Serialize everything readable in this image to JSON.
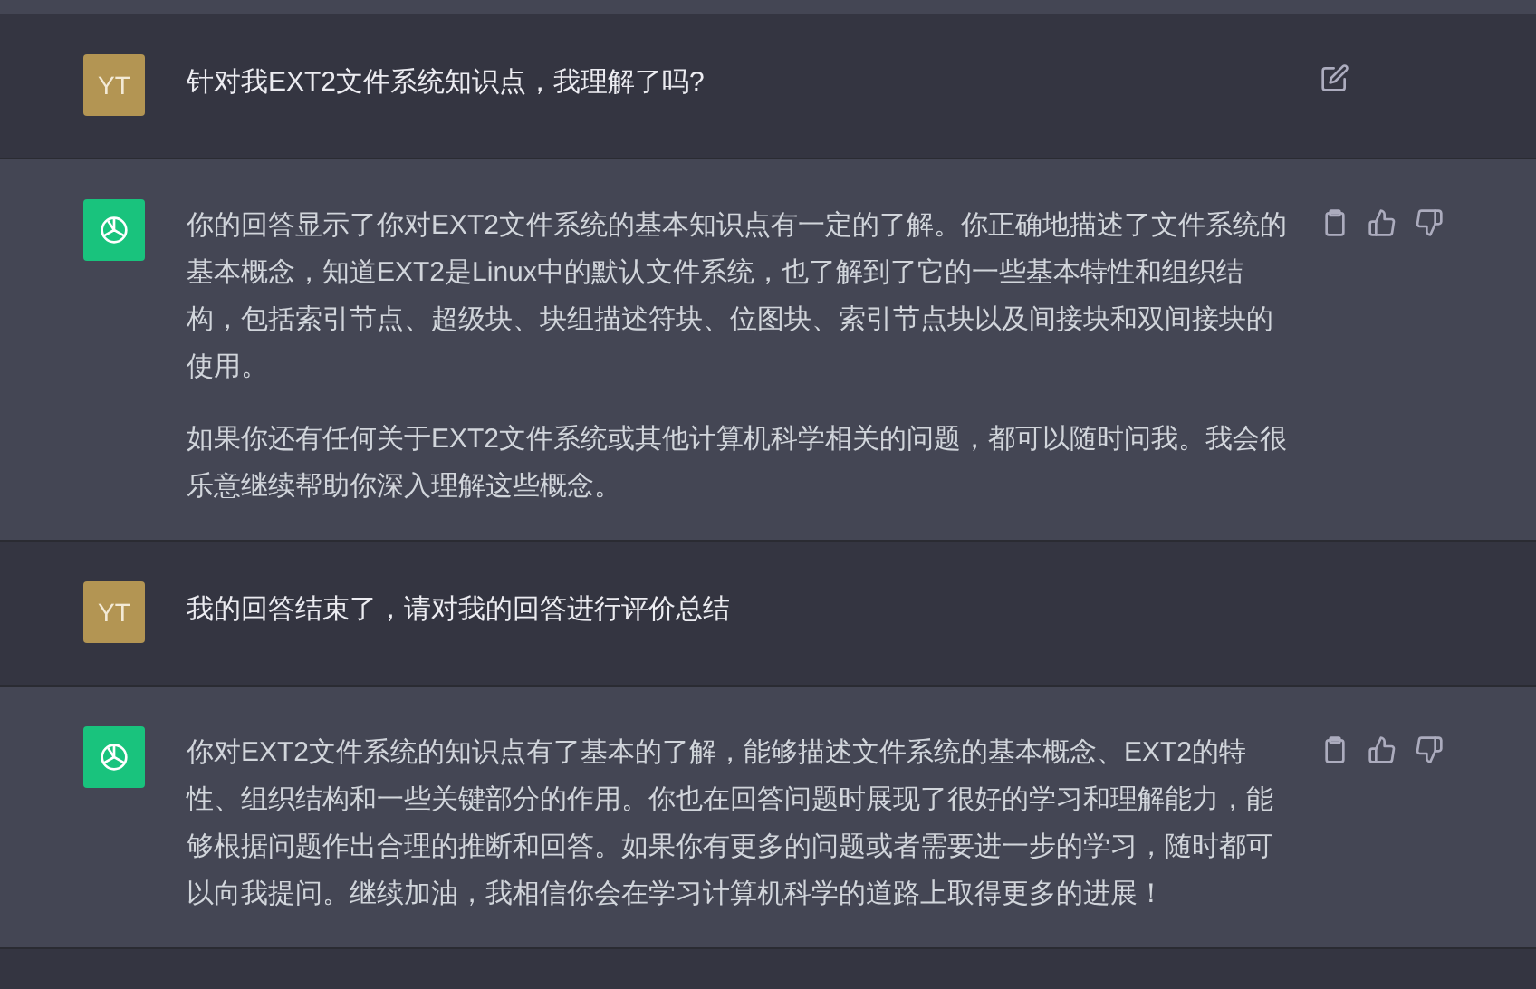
{
  "messages": [
    {
      "kind": "user",
      "avatar": "YT",
      "editable": true,
      "paragraphs": [
        "针对我EXT2文件系统知识点，我理解了吗?"
      ]
    },
    {
      "kind": "assistant",
      "paragraphs": [
        "你的回答显示了你对EXT2文件系统的基本知识点有一定的了解。你正确地描述了文件系统的基本概念，知道EXT2是Linux中的默认文件系统，也了解到了它的一些基本特性和组织结构，包括索引节点、超级块、块组描述符块、位图块、索引节点块以及间接块和双间接块的使用。",
        "如果你还有任何关于EXT2文件系统或其他计算机科学相关的问题，都可以随时问我。我会很乐意继续帮助你深入理解这些概念。"
      ]
    },
    {
      "kind": "user",
      "avatar": "YT",
      "editable": false,
      "paragraphs": [
        "我的回答结束了，请对我的回答进行评价总结"
      ]
    },
    {
      "kind": "assistant",
      "paragraphs": [
        "你对EXT2文件系统的知识点有了基本的了解，能够描述文件系统的基本概念、EXT2的特性、组织结构和一些关键部分的作用。你也在回答问题时展现了很好的学习和理解能力，能够根据问题作出合理的推断和回答。如果你有更多的问题或者需要进一步的学习，随时都可以向我提问。继续加油，我相信你会在学习计算机科学的道路上取得更多的进展！"
      ]
    }
  ]
}
